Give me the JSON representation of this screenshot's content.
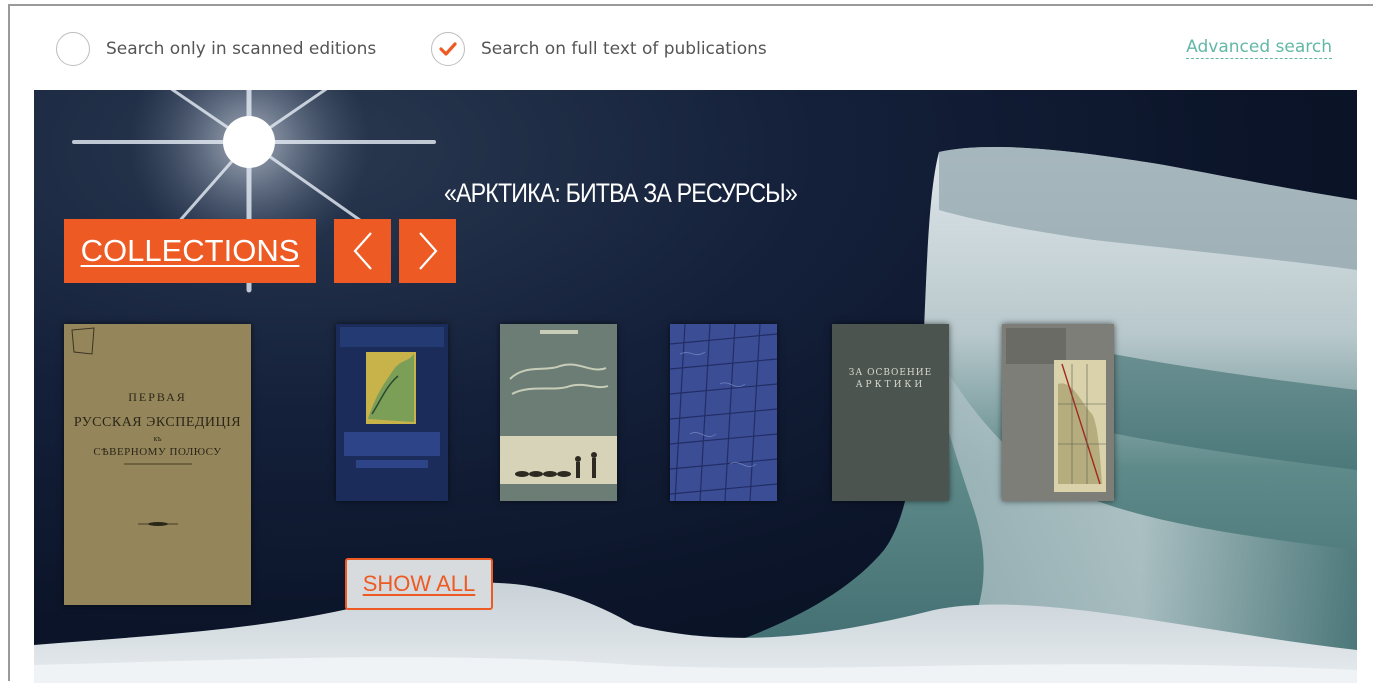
{
  "search_options": {
    "scanned_only": {
      "label": "Search only in scanned editions",
      "checked": false
    },
    "full_text": {
      "label": "Search on full text of publications",
      "checked": true
    },
    "advanced_link": "Advanced search"
  },
  "banner": {
    "title": "«АРКТИКА: БИТВА ЗА РЕСУРСЫ»",
    "collections_label": "COLLECTIONS",
    "prev_icon": "chevron-left-icon",
    "next_icon": "chevron-right-icon",
    "show_all_label": "SHOW ALL",
    "books": [
      {
        "lines": [
          "ПЕРВАЯ",
          "РУССКАЯ ЭКСПЕДИЦІЯ",
          "къ",
          "СѢВЕРНОМУ ПОЛЮСУ"
        ]
      },
      {
        "lines": []
      },
      {
        "lines": []
      },
      {
        "lines": []
      },
      {
        "lines": [
          "ЗА ОСВОЕНИЕ",
          "АРКТИКИ"
        ]
      },
      {
        "lines": []
      }
    ]
  },
  "colors": {
    "accent": "#ee5a24",
    "link": "#63b7a6",
    "check": "#ee5a24"
  }
}
